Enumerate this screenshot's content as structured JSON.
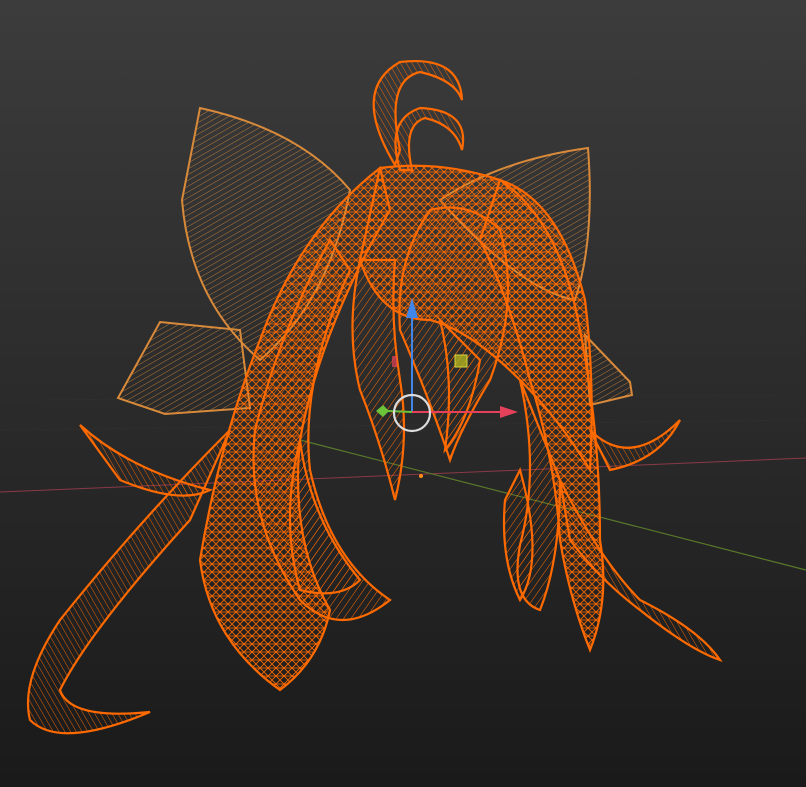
{
  "viewport": {
    "background_top": "#3c3c3c",
    "background_bottom": "#1a1a1a",
    "axis_x_color": "#8a3a46",
    "axis_y_color": "#5a7a2a",
    "grid_color": "#2e2e2e"
  },
  "selection": {
    "active_color": "#ff6a00",
    "selected_color": "#f08c30"
  },
  "gizmo": {
    "x_color": "#e6415a",
    "y_color": "#6cc33a",
    "z_color": "#3f86e8",
    "plane_color": "#b0b020",
    "center_color": "#dcdcdc",
    "icons": [
      "move-gizmo-icon",
      "arrow-x-icon",
      "arrow-y-icon",
      "arrow-z-icon",
      "plane-handle-icon",
      "view-circle-icon"
    ]
  }
}
